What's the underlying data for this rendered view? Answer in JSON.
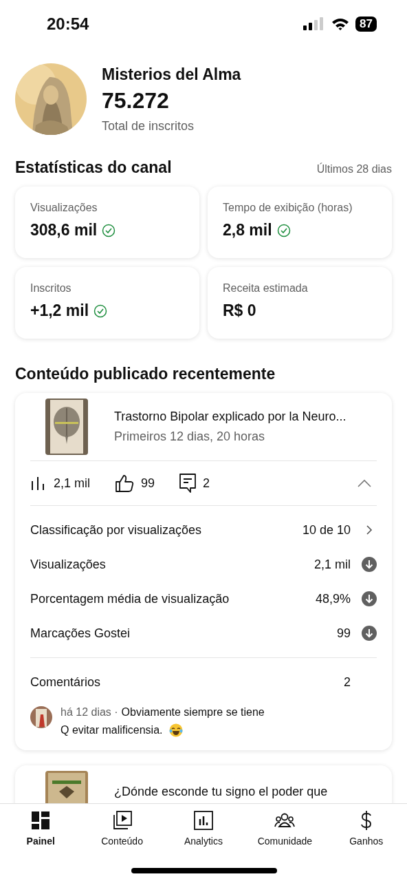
{
  "status_bar": {
    "time": "20:54",
    "battery": "87"
  },
  "channel": {
    "name": "Misterios del Alma",
    "subscribers": "75.272",
    "subscribers_label": "Total de inscritos"
  },
  "stats": {
    "title": "Estatísticas do canal",
    "period": "Últimos 28 dias",
    "cards": [
      {
        "label": "Visualizações",
        "value": "308,6 mil",
        "verified": true
      },
      {
        "label": "Tempo de exibição (horas)",
        "value": "2,8 mil",
        "verified": true
      },
      {
        "label": "Inscritos",
        "value": "+1,2 mil",
        "verified": true
      },
      {
        "label": "Receita estimada",
        "value": "R$ 0",
        "verified": false
      }
    ]
  },
  "recent": {
    "title": "Conteúdo publicado recentemente",
    "videos": [
      {
        "title": "Trastorno Bipolar explicado por la Neuro...",
        "subtitle": "Primeiros 12 dias, 20 horas",
        "views": "2,1 mil",
        "likes": "99",
        "comments": "2",
        "expanded": true,
        "rows": [
          {
            "kind": "link",
            "label": "Classificação por visualizações",
            "value": "10 de 10"
          },
          {
            "kind": "below",
            "label": "Visualizações",
            "value": "2,1 mil"
          },
          {
            "kind": "below",
            "label": "Porcentagem média de visualização",
            "value": "48,9%"
          },
          {
            "kind": "below",
            "label": "Marcações Gostei",
            "value": "99"
          }
        ],
        "comments_label": "Comentários",
        "comments_count": "2",
        "comment": {
          "age": "há 12 dias ·",
          "lines": [
            "Obviamente siempre se tiene",
            "Q evitar malificensia."
          ]
        }
      },
      {
        "title": "¿Dónde esconde tu signo el poder que"
      }
    ]
  },
  "nav": [
    {
      "label": "Painel",
      "selected": true
    },
    {
      "label": "Conteúdo",
      "selected": false
    },
    {
      "label": "Analytics",
      "selected": false
    },
    {
      "label": "Comunidade",
      "selected": false
    },
    {
      "label": "Ganhos",
      "selected": false
    }
  ]
}
